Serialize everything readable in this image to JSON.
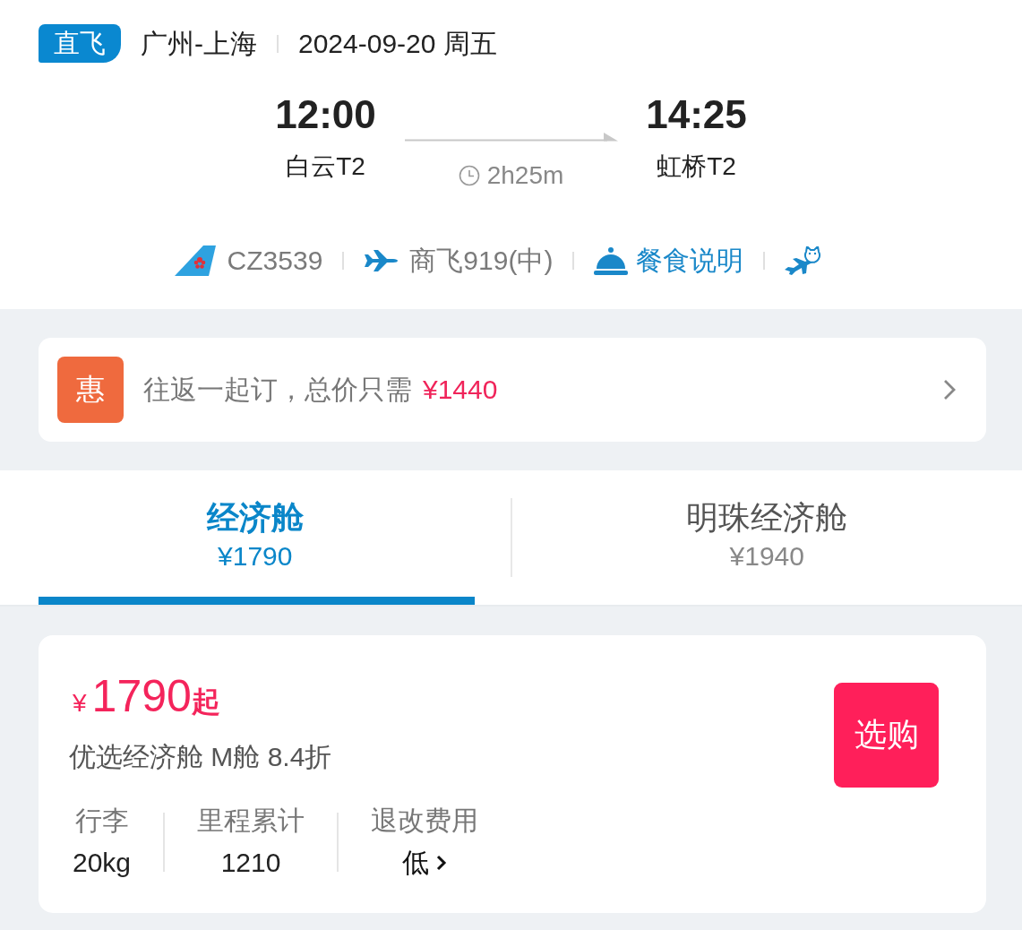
{
  "flight": {
    "type_badge": "直飞",
    "route": "广州-上海",
    "date": "2024-09-20 周五"
  },
  "schedule": {
    "departure": {
      "time": "12:00",
      "airport": "白云T2"
    },
    "duration": "2h25m",
    "arrival": {
      "time": "14:25",
      "airport": "虹桥T2"
    }
  },
  "details": [
    {
      "kind": "airline",
      "text": "CZ3539"
    },
    {
      "kind": "aircraft",
      "text": "商飞919(中)"
    },
    {
      "kind": "meal",
      "text": "餐食说明"
    },
    {
      "kind": "mascot"
    }
  ],
  "promo": {
    "badge": "惠",
    "text": "往返一起订，总价只需",
    "price": "¥1440"
  },
  "cabin_tabs": [
    {
      "label": "经济舱",
      "price": "¥1790",
      "selected": true
    },
    {
      "label": "明珠经济舱",
      "price": "¥1940",
      "selected": false
    }
  ],
  "fare": {
    "currency": "¥",
    "amount": "1790",
    "suffix": "起",
    "description": "优选经济舱 M舱 8.4折",
    "facts": [
      {
        "kind": "plain",
        "label": "行李",
        "value": "20kg"
      },
      {
        "kind": "plain",
        "label": "里程累计",
        "value": "1210"
      },
      {
        "kind": "link",
        "label": "退改费用",
        "value": "低"
      }
    ],
    "buy_button": "选购"
  }
}
